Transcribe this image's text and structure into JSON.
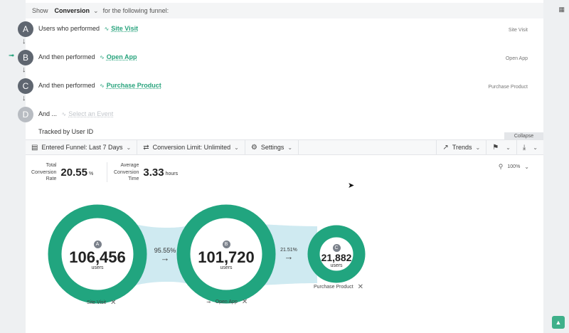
{
  "header": {
    "show_label": "Show",
    "metric": "Conversion",
    "suffix": "for the following funnel:"
  },
  "steps": [
    {
      "letter": "A",
      "prefix": "Users who performed",
      "event": "Site Visit",
      "right_label": "Site Visit"
    },
    {
      "letter": "B",
      "prefix": "And then performed",
      "event": "Open App",
      "right_label": "Open App"
    },
    {
      "letter": "C",
      "prefix": "And then performed",
      "event": "Purchase Product",
      "right_label": "Purchase Product"
    },
    {
      "letter": "D",
      "prefix": "And ...",
      "event": "Select an Event",
      "right_label": ""
    }
  ],
  "tracked_by": "Tracked by User ID",
  "collapse_label": "Collapse",
  "toolbar": {
    "entered_funnel": "Entered Funnel: Last 7 Days",
    "conversion_limit": "Conversion Limit: Unlimited",
    "settings": "Settings",
    "trends": "Trends"
  },
  "stats": {
    "total_label_1": "Total",
    "total_label_2": "Conversion",
    "total_label_3": "Rate",
    "total_value": "20.55",
    "total_unit": "%",
    "avg_label_1": "Average",
    "avg_label_2": "Conversion",
    "avg_label_3": "Time",
    "avg_value": "3.33",
    "avg_unit": "hours"
  },
  "zoom_label": "100%",
  "funnel": {
    "nodes": [
      {
        "letter": "A",
        "value": "106,456",
        "sub": "users",
        "caption": "Site Visit"
      },
      {
        "letter": "B",
        "value": "101,720",
        "sub": "users",
        "caption": "Open App"
      },
      {
        "letter": "C",
        "value": "21,882",
        "sub": "users",
        "caption": "Purchase Product"
      }
    ],
    "conversions": [
      "95.55%",
      "21.51%"
    ]
  },
  "colors": {
    "accent": "#27a37c",
    "ring": "#21a57f",
    "flow": "#cfeaf1"
  }
}
